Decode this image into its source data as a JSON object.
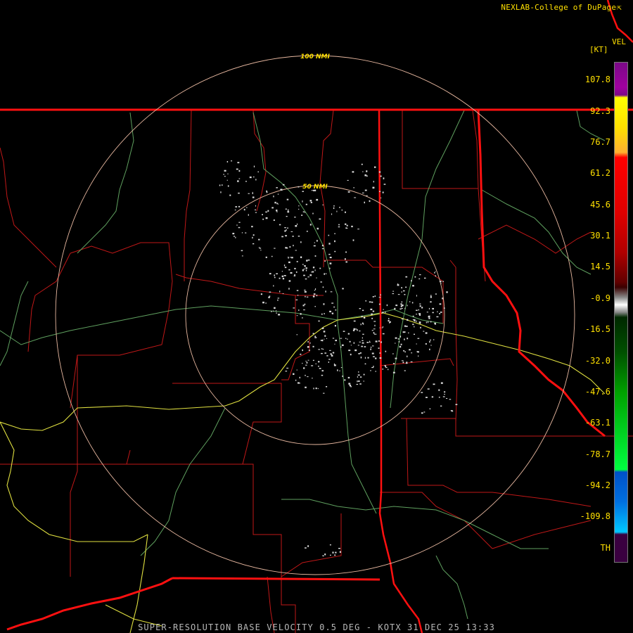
{
  "header": {
    "credit": "NEXLAB-College of DuPage",
    "credit_icon": "external-link-icon",
    "product": "VEL",
    "units": "[KT]"
  },
  "range_rings": [
    "100 NMI",
    "50 NMI"
  ],
  "velocity_scale": {
    "labels": [
      "107.8",
      "92.3",
      "76.7",
      "61.2",
      "45.6",
      "30.1",
      "14.5",
      "-0.9",
      "-16.5",
      "-32.0",
      "-47.6",
      "-63.1",
      "-78.7",
      "-94.2",
      "-109.8",
      "TH"
    ],
    "colors": {
      "top": "#7a0a87",
      "yellow": "#ffff00",
      "red": "#ff0000",
      "gray": "#888888",
      "green": "#00ff40",
      "blue": "#0050c8",
      "cyan": "#00c8ff",
      "bottom": "#3a0040"
    }
  },
  "footer": "SUPER-RESOLUTION BASE VELOCITY 0.5 DEG - KOTX 31 DEC 25 13:33",
  "colors": {
    "state_border": "#ff1010",
    "county_border": "#c01818",
    "river": "#5fa05f",
    "highway": "#e0e040",
    "range_ring": "#e8b8a0"
  }
}
